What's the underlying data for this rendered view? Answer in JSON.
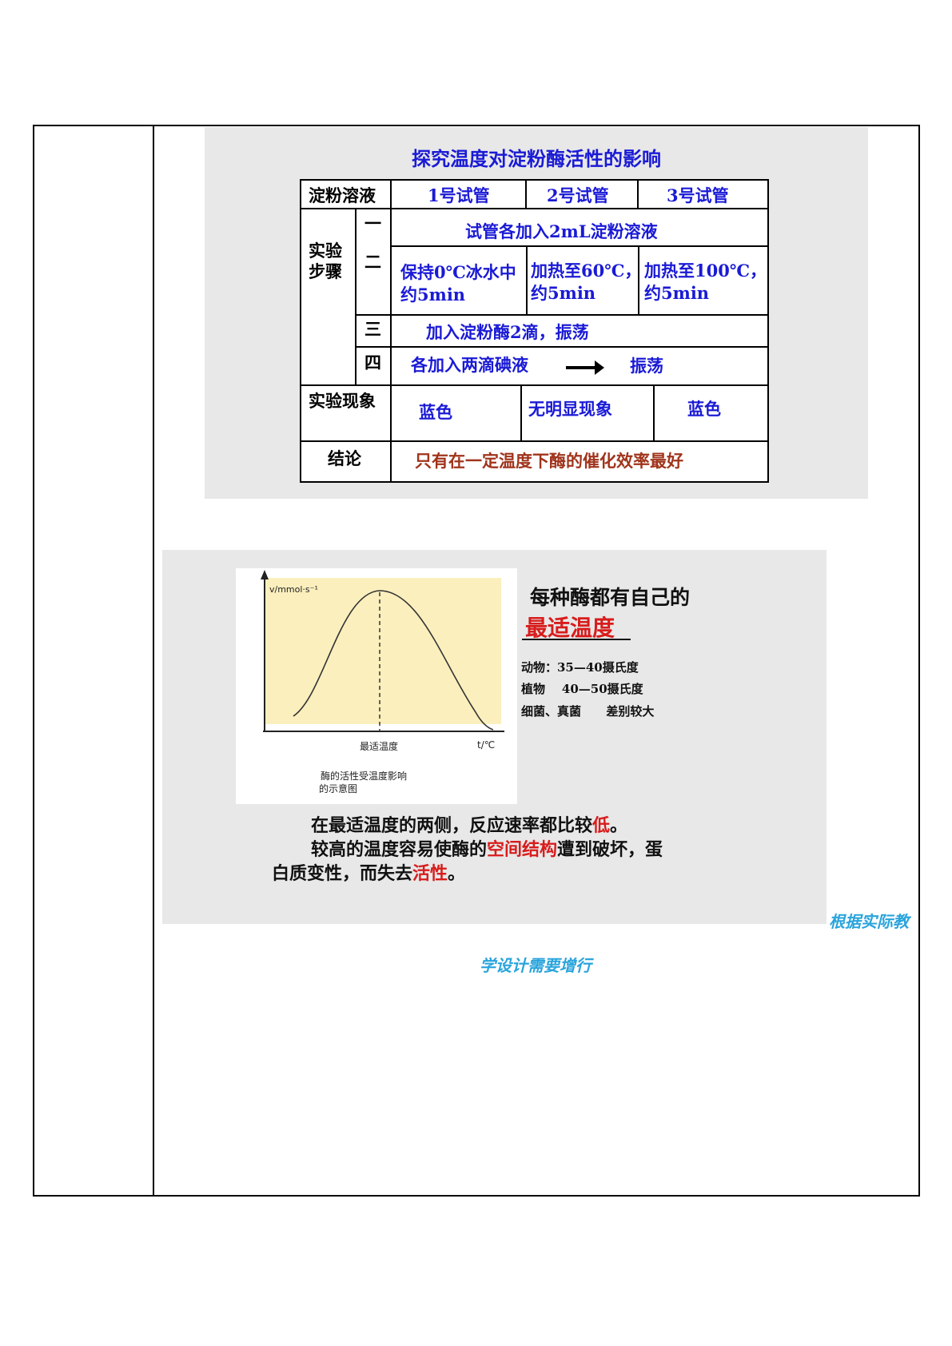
{
  "slide1": {
    "title": "探究温度对淀粉酶活性的影响",
    "headers": [
      "淀粉溶液",
      "1号试管",
      "2号试管",
      "3号试管"
    ],
    "steps_label_line1": "实验",
    "steps_label_line2": "步骤",
    "step_nums": [
      "一",
      "二",
      "三",
      "四"
    ],
    "step1_text": "试管各加入2mL淀粉溶液",
    "step2_cells": [
      {
        "line1": "保持0℃冰水中",
        "line2": "约5min"
      },
      {
        "line1": "加热至60℃，",
        "line2": "约5min"
      },
      {
        "line1": "加热至100℃，",
        "line2": "约5min"
      }
    ],
    "step3_text": "加入淀粉酶2滴，振荡",
    "step4_text_a": "各加入两滴碘液",
    "step4_text_b": "振荡",
    "phenomenon_label": "实验现象",
    "phenomena": [
      "蓝色",
      "无明显现象",
      "蓝色"
    ],
    "conclusion_label": "结论",
    "conclusion": "只有在一定温度下酶的催化效率最好"
  },
  "slide2": {
    "graph": {
      "y_axis_label": "v/mmol·s⁻¹",
      "x_axis_label": "t/℃",
      "peak_label": "最适温度",
      "caption_line1": "酶的活性受温度影响",
      "caption_line2": "的示意图",
      "curve": "bell-shaped, peak at optimum temperature"
    },
    "heading_line1": "每种酶都有自己的",
    "heading_line2": "最适温度",
    "items": [
      "动物：35—40摄氏度",
      "植物    40—50摄氏度",
      "细菌、真菌      差别较大"
    ],
    "para1_a": "在最适温度的两侧，反应速率都比较",
    "para1_b": "低",
    "para1_c": "。",
    "para2_a": "较高的温度容易使酶的",
    "para2_b": "空间结构",
    "para2_c": "遭到破坏，蛋",
    "para3_a": "白质变性，而失去",
    "para3_b": "活性",
    "para3_c": "。"
  },
  "note": {
    "line1": "根据实际教",
    "line2": "学设计需要增行"
  },
  "colors": {
    "blue_text": "#1a1ad6",
    "brown_text": "#a0341c",
    "red_text": "#d81c1c",
    "note_text": "#2aa4dc",
    "graph_fill": "#fbefbd",
    "slide_bg": "#e8e8e8"
  }
}
